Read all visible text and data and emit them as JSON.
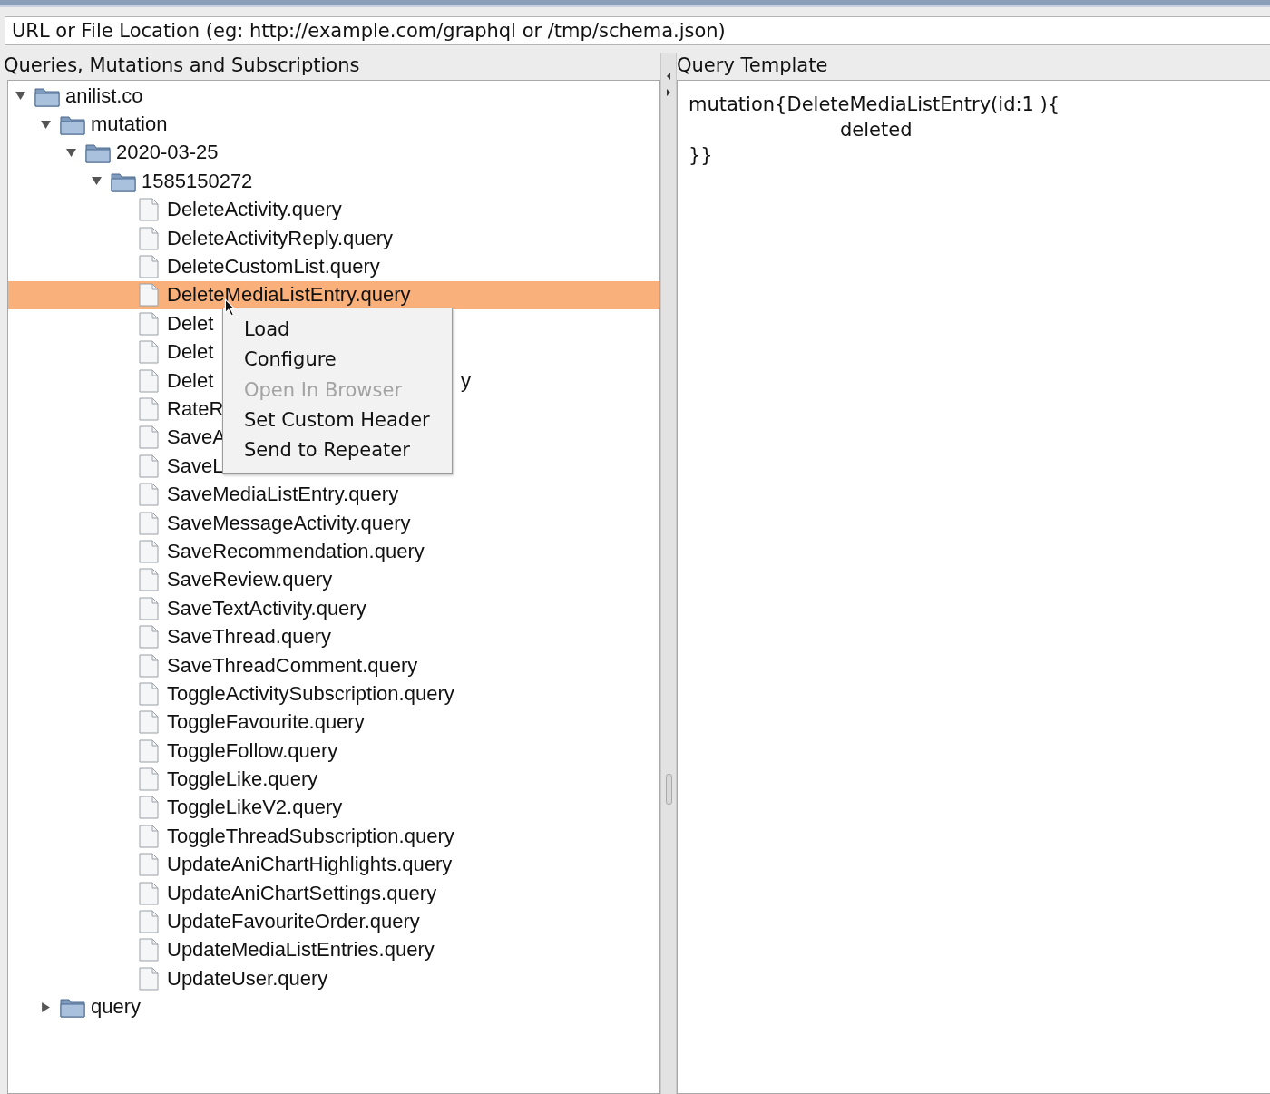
{
  "url_field": {
    "placeholder": "URL or File Location (eg: http://example.com/graphql or /tmp/schema.json)"
  },
  "left_panel": {
    "title": "Queries, Mutations and Subscriptions"
  },
  "right_panel": {
    "title": "Query Template"
  },
  "tree": [
    {
      "label": "anilist.co",
      "kind": "folder",
      "expanded": true,
      "children": [
        {
          "label": "mutation",
          "kind": "folder",
          "expanded": true,
          "children": [
            {
              "label": "2020-03-25",
              "kind": "folder",
              "expanded": true,
              "children": [
                {
                  "label": "1585150272",
                  "kind": "folder",
                  "expanded": true,
                  "children": [
                    {
                      "label": "DeleteActivity.query",
                      "kind": "file",
                      "selected": false
                    },
                    {
                      "label": "DeleteActivityReply.query",
                      "kind": "file",
                      "selected": false
                    },
                    {
                      "label": "DeleteCustomList.query",
                      "kind": "file",
                      "selected": false
                    },
                    {
                      "label": "DeleteMediaListEntry.query",
                      "kind": "file",
                      "selected": true
                    },
                    {
                      "label": "Delet",
                      "kind": "file",
                      "selected": false
                    },
                    {
                      "label": "Delet",
                      "kind": "file",
                      "selected": false
                    },
                    {
                      "label": "Delet",
                      "kind": "file",
                      "selected": false,
                      "tail": "y"
                    },
                    {
                      "label": "RateR",
                      "kind": "file",
                      "selected": false
                    },
                    {
                      "label": "SaveA",
                      "kind": "file",
                      "selected": false
                    },
                    {
                      "label": "SaveL",
                      "kind": "file",
                      "selected": false
                    },
                    {
                      "label": "SaveMediaListEntry.query",
                      "kind": "file",
                      "selected": false
                    },
                    {
                      "label": "SaveMessageActivity.query",
                      "kind": "file",
                      "selected": false
                    },
                    {
                      "label": "SaveRecommendation.query",
                      "kind": "file",
                      "selected": false
                    },
                    {
                      "label": "SaveReview.query",
                      "kind": "file",
                      "selected": false
                    },
                    {
                      "label": "SaveTextActivity.query",
                      "kind": "file",
                      "selected": false
                    },
                    {
                      "label": "SaveThread.query",
                      "kind": "file",
                      "selected": false
                    },
                    {
                      "label": "SaveThreadComment.query",
                      "kind": "file",
                      "selected": false
                    },
                    {
                      "label": "ToggleActivitySubscription.query",
                      "kind": "file",
                      "selected": false
                    },
                    {
                      "label": "ToggleFavourite.query",
                      "kind": "file",
                      "selected": false
                    },
                    {
                      "label": "ToggleFollow.query",
                      "kind": "file",
                      "selected": false
                    },
                    {
                      "label": "ToggleLike.query",
                      "kind": "file",
                      "selected": false
                    },
                    {
                      "label": "ToggleLikeV2.query",
                      "kind": "file",
                      "selected": false
                    },
                    {
                      "label": "ToggleThreadSubscription.query",
                      "kind": "file",
                      "selected": false
                    },
                    {
                      "label": "UpdateAniChartHighlights.query",
                      "kind": "file",
                      "selected": false
                    },
                    {
                      "label": "UpdateAniChartSettings.query",
                      "kind": "file",
                      "selected": false
                    },
                    {
                      "label": "UpdateFavouriteOrder.query",
                      "kind": "file",
                      "selected": false
                    },
                    {
                      "label": "UpdateMediaListEntries.query",
                      "kind": "file",
                      "selected": false
                    },
                    {
                      "label": "UpdateUser.query",
                      "kind": "file",
                      "selected": false
                    }
                  ]
                }
              ]
            }
          ]
        },
        {
          "label": "query",
          "kind": "folder",
          "expanded": false
        }
      ]
    }
  ],
  "context_menu": [
    {
      "label": "Load",
      "disabled": false
    },
    {
      "label": "Configure",
      "disabled": false
    },
    {
      "label": "Open In Browser",
      "disabled": true
    },
    {
      "label": "Set Custom Header",
      "disabled": false
    },
    {
      "label": "Send to Repeater",
      "disabled": false
    }
  ],
  "template_lines": [
    "mutation{DeleteMediaListEntry(id:1 ){",
    "deleted",
    "}}"
  ]
}
